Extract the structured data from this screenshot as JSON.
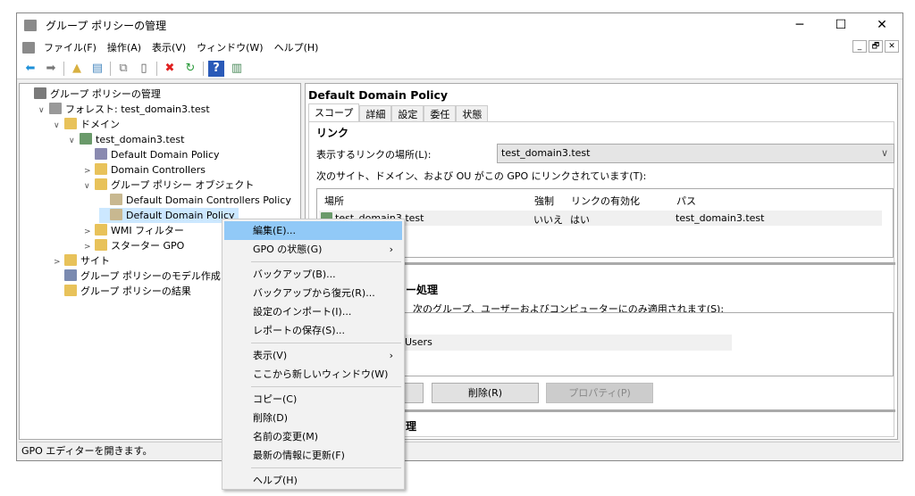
{
  "window": {
    "title": "グループ ポリシーの管理",
    "controls": {
      "minimize": "─",
      "maximize": "☐",
      "close": "✕"
    }
  },
  "menu": [
    "ファイル(F)",
    "操作(A)",
    "表示(V)",
    "ウィンドウ(W)",
    "ヘルプ(H)"
  ],
  "mdi_controls": [
    "_",
    "🗗",
    "✕"
  ],
  "toolbar": [
    "back-icon",
    "forward-icon",
    "up-folder-icon",
    "show-hide-tree-icon",
    "copy-icon",
    "paste-icon",
    "delete-icon",
    "refresh-icon",
    "help-icon",
    "action-pane-icon"
  ],
  "tree": [
    {
      "label": "グループ ポリシーの管理",
      "indent": 0,
      "toggle": "",
      "color": "#7a7a7a"
    },
    {
      "label": "フォレスト: test_domain3.test",
      "indent": 1,
      "toggle": "∨",
      "color": "#999999"
    },
    {
      "label": "ドメイン",
      "indent": 2,
      "toggle": "∨",
      "color": "#e8c25a"
    },
    {
      "label": "test_domain3.test",
      "indent": 3,
      "toggle": "∨",
      "color": "#6a9a6a"
    },
    {
      "label": "Default Domain Policy",
      "indent": 4,
      "toggle": "",
      "color": "#8a8ab0"
    },
    {
      "label": "Domain Controllers",
      "indent": 4,
      "toggle": ">",
      "color": "#e8c25a"
    },
    {
      "label": "グループ ポリシー オブジェクト",
      "indent": 4,
      "toggle": "∨",
      "color": "#e8c25a"
    },
    {
      "label": "Default Domain Controllers Policy",
      "indent": 5,
      "toggle": "",
      "color": "#c8b890"
    },
    {
      "label": "Default Domain Policy",
      "indent": 5,
      "toggle": "",
      "color": "#c8b890",
      "selected": true
    },
    {
      "label": "WMI フィルター",
      "indent": 4,
      "toggle": ">",
      "color": "#e8c25a"
    },
    {
      "label": "スターター GPO",
      "indent": 4,
      "toggle": ">",
      "color": "#e8c25a"
    },
    {
      "label": "サイト",
      "indent": 2,
      "toggle": ">",
      "color": "#e8c25a"
    },
    {
      "label": "グループ ポリシーのモデル作成",
      "indent": 2,
      "toggle": "",
      "color": "#7a8ab0"
    },
    {
      "label": "グループ ポリシーの結果",
      "indent": 2,
      "toggle": "",
      "color": "#e8c25a"
    }
  ],
  "right": {
    "title": "Default Domain Policy",
    "tabs": [
      "スコープ",
      "詳細",
      "設定",
      "委任",
      "状態"
    ],
    "links": {
      "heading": "リンク",
      "location_label": "表示するリンクの場所(L):",
      "location_value": "test_domain3.test",
      "desc": "次のサイト、ドメイン、および OU がこの GPO にリンクされています(T):",
      "columns": [
        "場所",
        "強制",
        "リンクの有効化",
        "パス"
      ],
      "rows": [
        [
          "test_domain3.test",
          "いいえ",
          "はい",
          "test_domain3.test"
        ]
      ]
    },
    "security": {
      "heading_partial": "ー処理",
      "desc_partial": "次のグループ、ユーザーおよびコンピューターにのみ適用されます(S):",
      "row_partial": "Users",
      "remove": "削除(R)",
      "properties": "プロパティ(P)"
    },
    "wmi": {
      "heading_partial": "理"
    }
  },
  "status": "GPO エディターを開きます。",
  "context_menu": [
    {
      "label": "編集(E)...",
      "highlight": true
    },
    {
      "label": "GPO の状態(G)",
      "submenu": true
    },
    {
      "sep": true
    },
    {
      "label": "バックアップ(B)..."
    },
    {
      "label": "バックアップから復元(R)..."
    },
    {
      "label": "設定のインポート(I)..."
    },
    {
      "label": "レポートの保存(S)..."
    },
    {
      "sep": true
    },
    {
      "label": "表示(V)",
      "submenu": true
    },
    {
      "label": "ここから新しいウィンドウ(W)"
    },
    {
      "sep": true
    },
    {
      "label": "コピー(C)"
    },
    {
      "label": "削除(D)"
    },
    {
      "label": "名前の変更(M)"
    },
    {
      "label": "最新の情報に更新(F)"
    },
    {
      "sep": true
    },
    {
      "label": "ヘルプ(H)"
    }
  ],
  "submenu_arrow": "›"
}
